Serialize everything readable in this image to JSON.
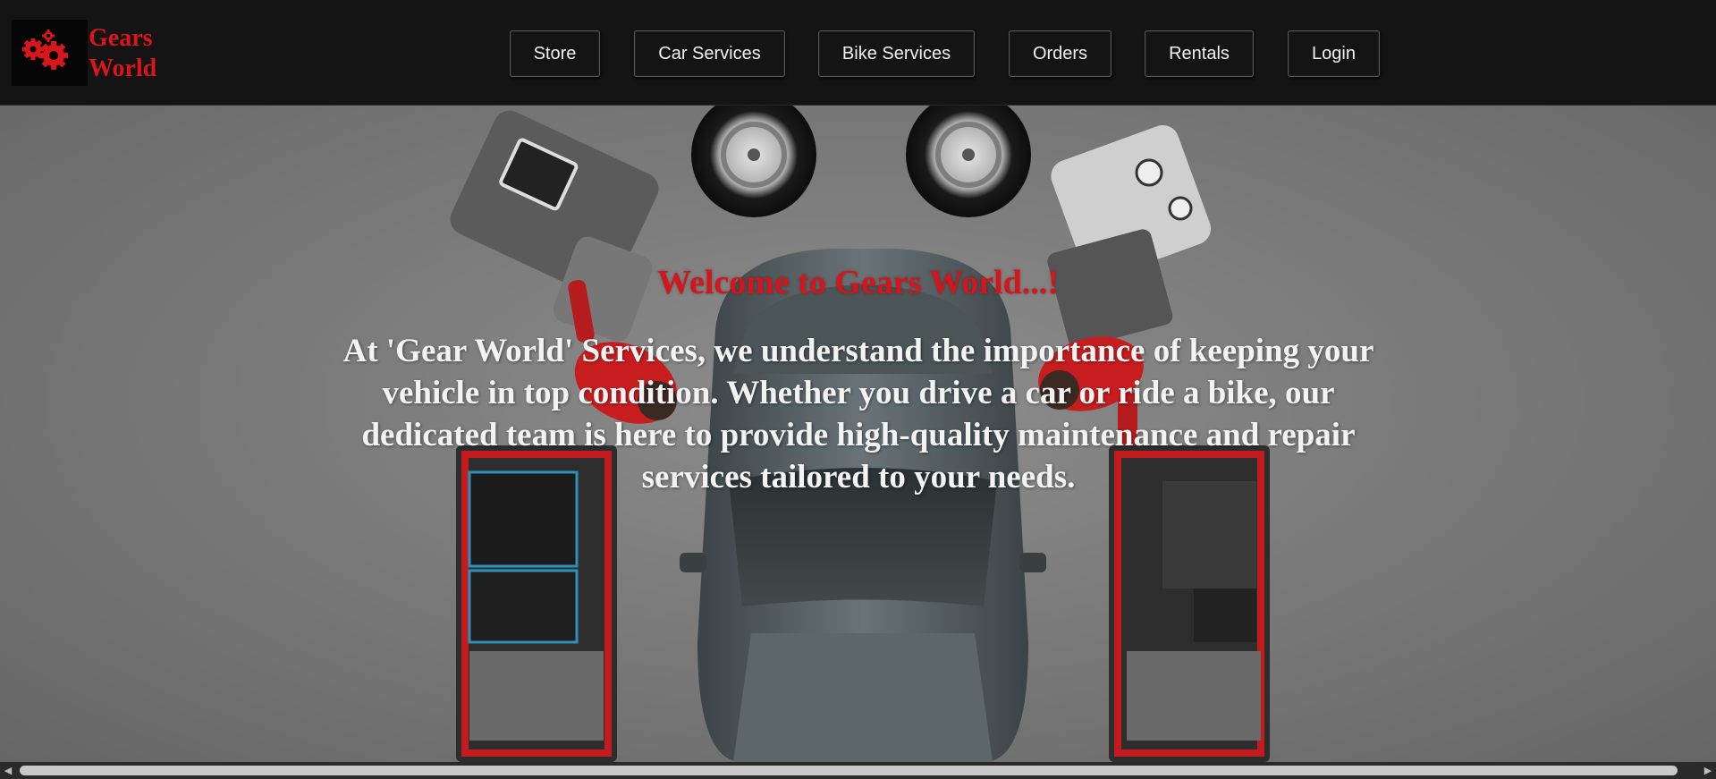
{
  "brand": {
    "logo_icon": "gears-icon",
    "line1": "Gears",
    "line2": "World",
    "color": "#d8161b"
  },
  "nav": {
    "items": [
      {
        "label": "Store"
      },
      {
        "label": "Car Services"
      },
      {
        "label": "Bike Services"
      },
      {
        "label": "Orders"
      },
      {
        "label": "Rentals"
      },
      {
        "label": "Login"
      }
    ]
  },
  "hero": {
    "title": "Welcome to Gears World...!",
    "text": "At 'Gear World' Services, we understand the importance of keeping your vehicle in top condition. Whether you drive a car or ride a bike, our dedicated team is here to provide high-quality maintenance and repair services tailored to your needs.",
    "title_color": "#d2161b",
    "text_color": "#f3f3f3",
    "background_image": "car-service-garage-image"
  },
  "scrollbar": {
    "left_icon": "scroll-left-arrow-icon",
    "right_icon": "scroll-right-arrow-icon"
  }
}
